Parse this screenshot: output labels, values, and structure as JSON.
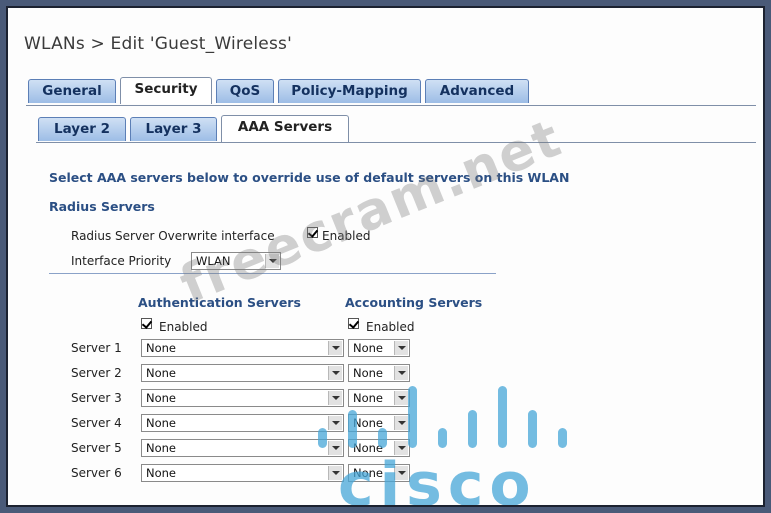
{
  "page": {
    "title": "WLANs > Edit  'Guest_Wireless'"
  },
  "tabs": [
    "General",
    "Security",
    "QoS",
    "Policy-Mapping",
    "Advanced"
  ],
  "subtabs": [
    "Layer 2",
    "Layer 3",
    "AAA Servers"
  ],
  "content": {
    "heading": "Select AAA servers below to override use of default servers on this WLAN",
    "radius_heading": "Radius Servers",
    "overwrite_label": "Radius Server Overwrite interface",
    "overwrite_enabled": "Enabled",
    "priority_label": "Interface Priority",
    "priority_value": "WLAN",
    "auth_heading": "Authentication Servers",
    "acct_heading": "Accounting Servers",
    "auth_enabled": "Enabled",
    "acct_enabled": "Enabled"
  },
  "servers": [
    {
      "label": "Server 1",
      "auth": "None",
      "acct": "None"
    },
    {
      "label": "Server 2",
      "auth": "None",
      "acct": "None"
    },
    {
      "label": "Server 3",
      "auth": "None",
      "acct": "None"
    },
    {
      "label": "Server 4",
      "auth": "None",
      "acct": "None"
    },
    {
      "label": "Server 5",
      "auth": "None",
      "acct": "None"
    },
    {
      "label": "Server 6",
      "auth": "None",
      "acct": "None"
    }
  ],
  "watermark": {
    "text": "freecram.net"
  },
  "logo": {
    "text": "cisco"
  }
}
